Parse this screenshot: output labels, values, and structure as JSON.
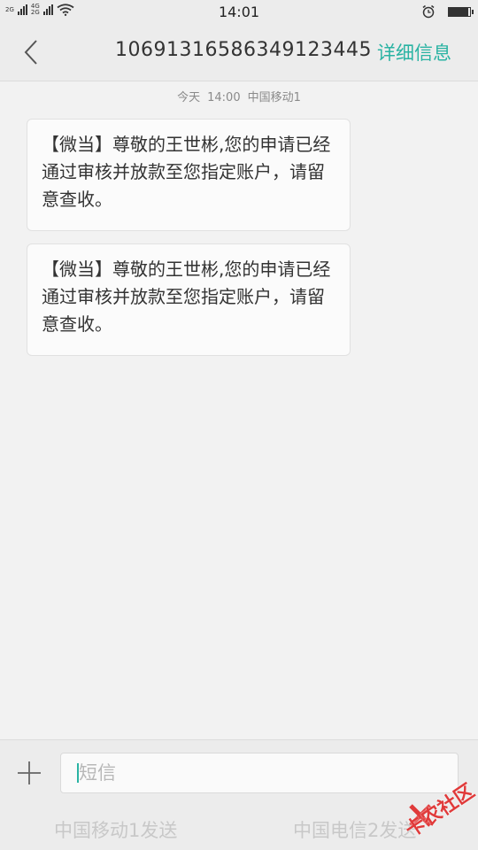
{
  "status_bar": {
    "net1": "2G",
    "net2_top": "4G",
    "net2_bottom": "2G",
    "time": "14:01",
    "battery_level": 0.9
  },
  "header": {
    "sender": "1069131658634912​3445",
    "detail_label": "详细信息"
  },
  "thread": {
    "day": "今天",
    "time": "14:00",
    "carrier": "中国移动1"
  },
  "messages": [
    {
      "text": "【微当】尊敬的王世彬,您的申请已经通过审核并放款至您指定账户，请留意查收。"
    },
    {
      "text": "【微当】尊敬的王世彬,您的申请已经通过审核并放款至您指定账户，请留意查收。"
    }
  ],
  "compose": {
    "placeholder": "短信",
    "send_sim1": "中国移动1发送",
    "send_sim2": "中国电信2发送"
  },
  "watermark": {
    "text": "卡农社区"
  },
  "colors": {
    "accent": "#2ab3a3",
    "watermark": "#e03a3a"
  }
}
